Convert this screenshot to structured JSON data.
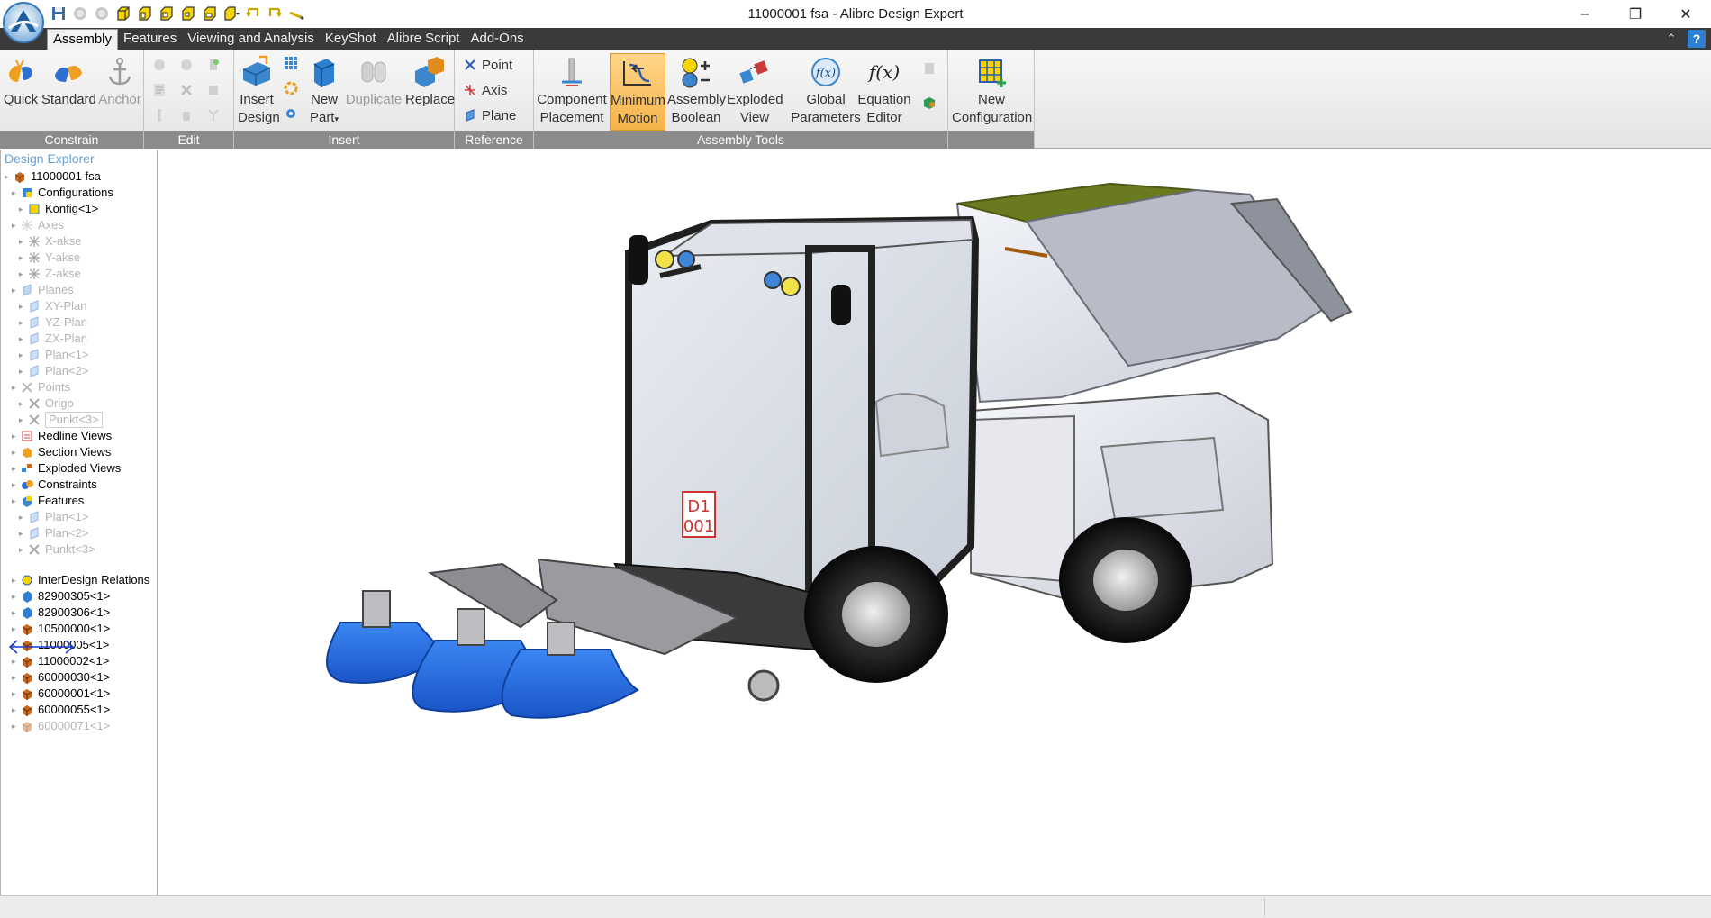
{
  "window": {
    "title": "11000001 fsa - Alibre Design Expert",
    "minimize": "–",
    "restore": "❐",
    "close": "✕"
  },
  "quick_access": {
    "icons": [
      "save-icon",
      "undo-circle-icon",
      "redo-circle-icon",
      "box-view-icon",
      "box-view-icon",
      "box-view-icon",
      "box-view-icon",
      "box-view-icon",
      "box-view-dropdown-icon",
      "arrow-left-icon",
      "arrow-right-icon",
      "pencil-icon"
    ]
  },
  "menu": {
    "tabs": [
      "Assembly",
      "Features",
      "Viewing and Analysis",
      "KeyShot",
      "Alibre Script",
      "Add-Ons"
    ],
    "active": "Assembly",
    "collapse": "⌃",
    "help": "?"
  },
  "ribbon": {
    "constrain": {
      "label": "Constrain",
      "quick": "Quick",
      "standard": "Standard",
      "anchor": "Anchor"
    },
    "edit": {
      "label": "Edit"
    },
    "insert": {
      "label": "Insert",
      "insert_design_1": "Insert",
      "insert_design_2": "Design",
      "new_part_1": "New",
      "new_part_2": "Part",
      "duplicate": "Duplicate",
      "replace": "Replace"
    },
    "reference": {
      "label": "Reference",
      "point": "Point",
      "axis": "Axis",
      "plane": "Plane"
    },
    "assembly_tools": {
      "label": "Assembly Tools",
      "component_placement_1": "Component",
      "component_placement_2": "Placement",
      "minimum_motion_1": "Minimum",
      "minimum_motion_2": "Motion",
      "assembly_boolean_1": "Assembly",
      "assembly_boolean_2": "Boolean",
      "exploded_view_1": "Exploded",
      "exploded_view_2": "View",
      "global_parameters_1": "Global",
      "global_parameters_2": "Parameters",
      "equation_editor_1": "Equation",
      "equation_editor_2": "Editor",
      "new_configuration_1": "New",
      "new_configuration_2": "Configuration"
    }
  },
  "explorer": {
    "title": "Design Explorer",
    "items": [
      {
        "label": "11000001 fsa",
        "icon": "assembly-icon",
        "dim": false
      },
      {
        "label": "Configurations",
        "icon": "configurations-icon",
        "dim": false
      },
      {
        "label": "Konfig<1>",
        "icon": "configuration-icon",
        "dim": false
      },
      {
        "label": "Axes",
        "icon": "axes-icon",
        "dim": true
      },
      {
        "label": "X-akse",
        "icon": "axis-icon",
        "dim": true
      },
      {
        "label": "Y-akse",
        "icon": "axis-icon",
        "dim": true
      },
      {
        "label": "Z-akse",
        "icon": "axis-icon",
        "dim": true
      },
      {
        "label": "Planes",
        "icon": "planes-icon",
        "dim": true
      },
      {
        "label": "XY-Plan",
        "icon": "plane-icon",
        "dim": true
      },
      {
        "label": "YZ-Plan",
        "icon": "plane-icon",
        "dim": true
      },
      {
        "label": "ZX-Plan",
        "icon": "plane-icon",
        "dim": true
      },
      {
        "label": "Plan<1>",
        "icon": "plane-icon",
        "dim": true
      },
      {
        "label": "Plan<2>",
        "icon": "plane-icon",
        "dim": true
      },
      {
        "label": "Points",
        "icon": "points-icon",
        "dim": true
      },
      {
        "label": "Origo",
        "icon": "point-icon",
        "dim": true
      },
      {
        "label": "Punkt<3>",
        "icon": "point-icon",
        "dim": true
      },
      {
        "label": "Redline Views",
        "icon": "redline-icon",
        "dim": false
      },
      {
        "label": "Section Views",
        "icon": "section-icon",
        "dim": false
      },
      {
        "label": "Exploded Views",
        "icon": "exploded-icon",
        "dim": false
      },
      {
        "label": "Constraints",
        "icon": "constraints-icon",
        "dim": false
      },
      {
        "label": "Features",
        "icon": "features-icon",
        "dim": false
      },
      {
        "label": "Plan<1>",
        "icon": "plane-icon",
        "dim": true
      },
      {
        "label": "Plan<2>",
        "icon": "plane-icon",
        "dim": true
      },
      {
        "label": "Punkt<3>",
        "icon": "point-icon",
        "dim": true
      },
      {
        "label": "InterDesign Relations",
        "icon": "interdesign-icon",
        "dim": false
      },
      {
        "label": "82900305<1>",
        "icon": "part-icon",
        "dim": false
      },
      {
        "label": "82900306<1>",
        "icon": "part-icon",
        "dim": false
      },
      {
        "label": "10500000<1>",
        "icon": "subassembly-icon",
        "dim": false
      },
      {
        "label": "11000005<1>",
        "icon": "subassembly-icon",
        "dim": false
      },
      {
        "label": "11000002<1>",
        "icon": "subassembly-icon",
        "dim": false
      },
      {
        "label": "60000030<1>",
        "icon": "subassembly-icon",
        "dim": false
      },
      {
        "label": "60000001<1>",
        "icon": "subassembly-icon",
        "dim": false
      },
      {
        "label": "60000055<1>",
        "icon": "subassembly-icon",
        "dim": false
      },
      {
        "label": "60000071<1>",
        "icon": "subassembly-icon",
        "dim": true
      }
    ]
  },
  "viewport": {
    "cab_label_1": "D1",
    "cab_label_2": "001"
  },
  "status": {
    "text": ""
  },
  "colors": {
    "menu_bg": "#3a3a3a",
    "group_label_bg": "#8b8b8b",
    "highlight": "#f6b34a",
    "brush_blue": "#1f63d8",
    "hopper_olive": "#6a7a1e"
  }
}
